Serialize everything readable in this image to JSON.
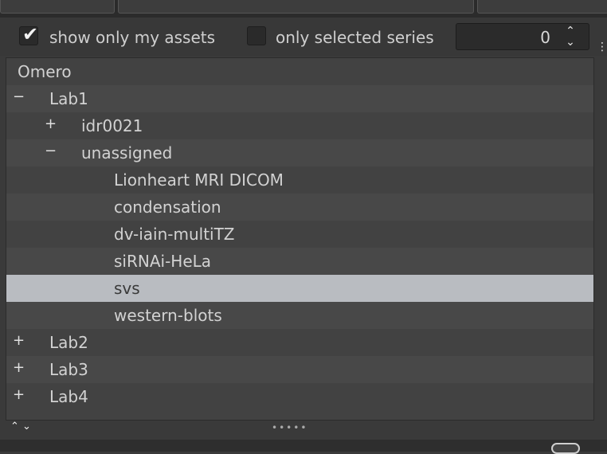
{
  "toolbar": {
    "show_only_my_assets": {
      "label": "show only my assets",
      "checked": true,
      "check_glyph": "✔"
    },
    "only_selected_series": {
      "label": "only selected series",
      "checked": false
    },
    "spinbox": {
      "value": "0",
      "up_glyph": "⌃",
      "down_glyph": "⌄"
    },
    "side_handle_glyph": "⋮"
  },
  "tree": {
    "rows": [
      {
        "label": "Omero",
        "toggle": ""
      },
      {
        "label": "Lab1",
        "toggle": "−"
      },
      {
        "label": "idr0021",
        "toggle": "+"
      },
      {
        "label": "unassigned",
        "toggle": "−"
      },
      {
        "label": "Lionheart MRI DICOM",
        "toggle": ""
      },
      {
        "label": "condensation",
        "toggle": ""
      },
      {
        "label": "dv-iain-multiTZ",
        "toggle": ""
      },
      {
        "label": "siRNAi-HeLa",
        "toggle": ""
      },
      {
        "label": "svs",
        "toggle": ""
      },
      {
        "label": "western-blots",
        "toggle": ""
      },
      {
        "label": "Lab2",
        "toggle": "+"
      },
      {
        "label": "Lab3",
        "toggle": "+"
      },
      {
        "label": "Lab4",
        "toggle": "+"
      }
    ],
    "selected_label": "svs"
  },
  "footer": {
    "collapse_arrows": "⌃ ⌄",
    "resize_grip": "•••••"
  }
}
